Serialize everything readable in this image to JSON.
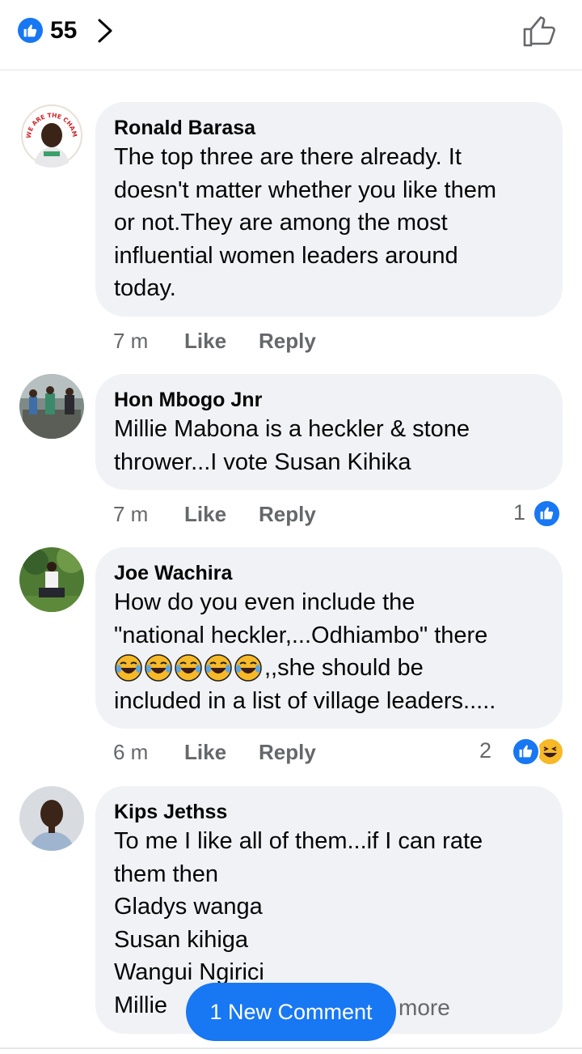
{
  "header": {
    "reaction_count": "55"
  },
  "colors": {
    "accent": "#1877f2",
    "bubble": "#f0f2f5",
    "meta_text": "#65676b",
    "haha": "#f7b928"
  },
  "comments": [
    {
      "author": "Ronald Barasa",
      "text": "The top three are there already. It\ndoesn't matter whether you like them\nor not.They are among the most\ninfluential women leaders around\ntoday.",
      "time": "7 m",
      "like": "Like",
      "reply": "Reply",
      "reactions": ""
    },
    {
      "author": "Hon Mbogo Jnr",
      "text": "Millie Mabona is a heckler & stone\nthrower...I vote Susan Kihika",
      "time": "7 m",
      "like": "Like",
      "reply": "Reply",
      "reactions": "1"
    },
    {
      "author": "Joe Wachira",
      "text_line1": "How do you even include the",
      "text_line2": "\"national heckler,...Odhiambo\" there",
      "text_line3": ",,she should be",
      "text_line4": "included in a list of village leaders.....",
      "time": "6 m",
      "like": "Like",
      "reply": "Reply",
      "reactions": "2"
    },
    {
      "author": "Kips Jethss",
      "text": "To me I like all of them...if I can rate\nthem then\nGladys wanga\nSusan kihiga\nWangui Ngirici\nMillie",
      "see_more": "more"
    }
  ],
  "avatar_text": "WE ARE THE CHAMPIONS",
  "new_comment_button": "1 New Comment",
  "icons": [
    "like-icon",
    "chevron-right-icon",
    "thumbs-up-outline-icon",
    "haha-icon"
  ]
}
